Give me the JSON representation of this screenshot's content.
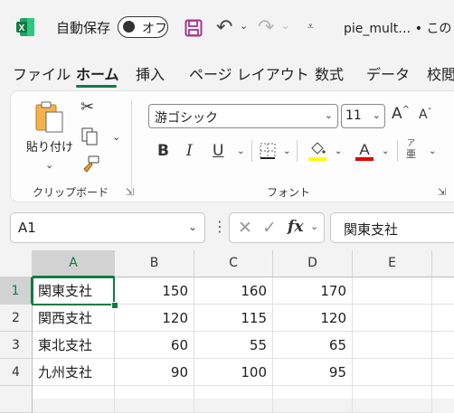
{
  "titlebar": {
    "autosave_label": "自動保存",
    "autosave_state": "オフ",
    "filename": "pie_mult… • この"
  },
  "tabs": [
    "ファイル",
    "ホーム",
    "挿入",
    "ページ レイアウト",
    "数式",
    "データ",
    "校閲"
  ],
  "ribbon": {
    "clipboard": {
      "paste_label": "貼り付け",
      "group_label": "クリップボード"
    },
    "font": {
      "font_name": "游ゴシック",
      "font_size": "11",
      "group_label": "フォント",
      "bold": "B",
      "italic": "I",
      "underline": "U",
      "font_color_glyph": "A",
      "phonetic_top": "ア",
      "phonetic_bottom": "亜",
      "grow_glyph": "A",
      "shrink_glyph": "A"
    }
  },
  "formula_bar": {
    "name_box": "A1",
    "fx": "fx",
    "formula": "関東支社"
  },
  "grid": {
    "columns": [
      "A",
      "B",
      "C",
      "D",
      "E"
    ],
    "rows": [
      {
        "num": "1",
        "cells": [
          "関東支社",
          "150",
          "160",
          "170",
          ""
        ]
      },
      {
        "num": "2",
        "cells": [
          "関西支社",
          "120",
          "115",
          "120",
          ""
        ]
      },
      {
        "num": "3",
        "cells": [
          "東北支社",
          "60",
          "55",
          "65",
          ""
        ]
      },
      {
        "num": "4",
        "cells": [
          "九州支社",
          "90",
          "100",
          "95",
          ""
        ]
      },
      {
        "num": "",
        "cells": [
          "",
          "",
          "",
          "",
          ""
        ]
      }
    ]
  },
  "colors": {
    "accent": "#107c41",
    "font_color_bar": "#e00000",
    "highlight_bar": "#ffff00"
  }
}
